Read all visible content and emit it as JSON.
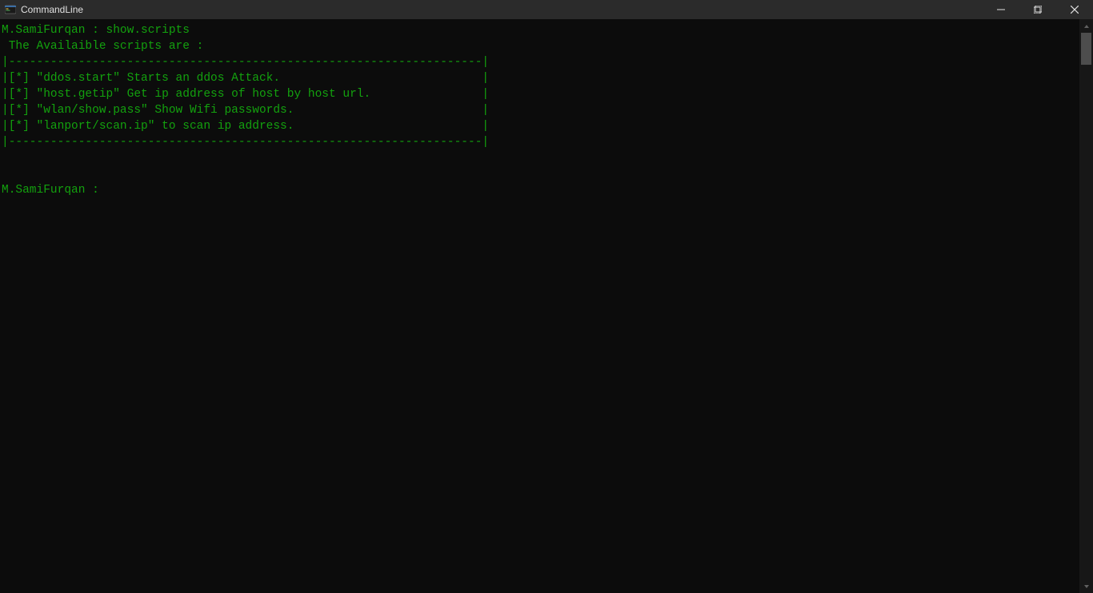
{
  "window": {
    "title": "CommandLine"
  },
  "terminal": {
    "lines": [
      "M.SamiFurqan : show.scripts",
      " The Availaible scripts are :",
      "|--------------------------------------------------------------------|",
      "|[*] \"ddos.start\" Starts an ddos Attack.                             |",
      "|[*] \"host.getip\" Get ip address of host by host url.                |",
      "|[*] \"wlan/show.pass\" Show Wifi passwords.                           |",
      "|[*] \"lanport/scan.ip\" to scan ip address.                           |",
      "|--------------------------------------------------------------------|",
      "",
      "",
      "M.SamiFurqan : "
    ]
  }
}
